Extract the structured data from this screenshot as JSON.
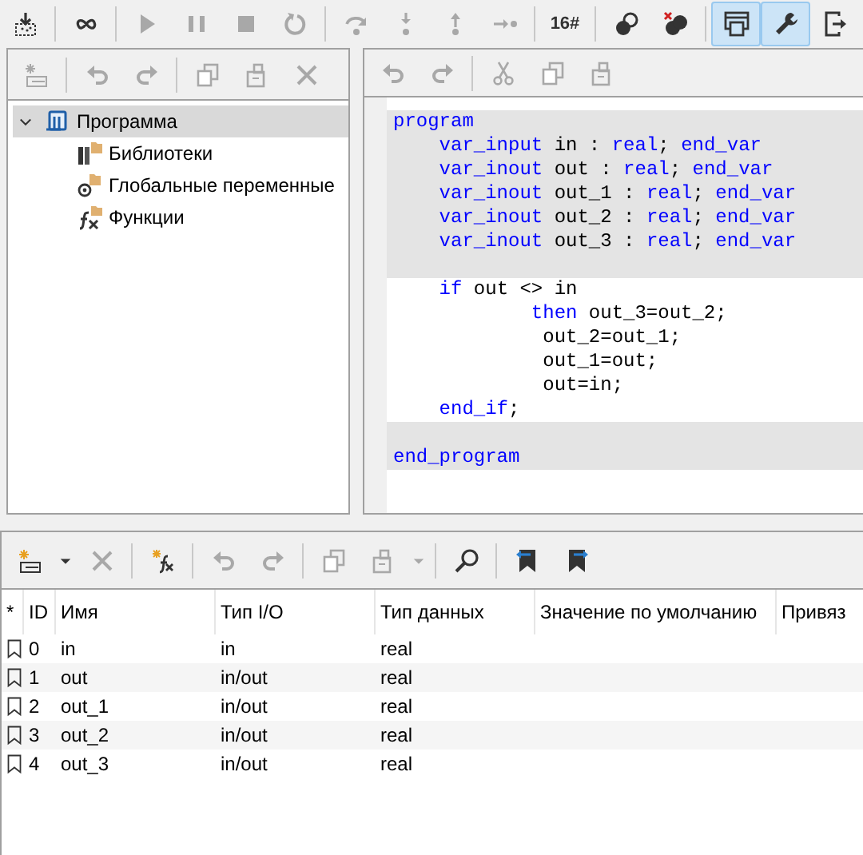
{
  "main_toolbar": [
    {
      "kind": "button",
      "disabled": false
    },
    {
      "kind": "separator"
    },
    {
      "kind": "button",
      "disabled": false
    },
    {
      "kind": "separator"
    },
    {
      "kind": "button",
      "disabled": true
    },
    {
      "kind": "button",
      "disabled": true
    },
    {
      "kind": "button",
      "disabled": true
    },
    {
      "kind": "button",
      "disabled": true
    },
    {
      "kind": "separator"
    },
    {
      "kind": "button",
      "disabled": true
    },
    {
      "kind": "button",
      "disabled": true
    },
    {
      "kind": "button",
      "disabled": true
    },
    {
      "kind": "button",
      "disabled": true
    },
    {
      "kind": "separator"
    },
    {
      "kind": "text-button",
      "label": "16#",
      "disabled": false
    },
    {
      "kind": "separator"
    },
    {
      "kind": "button",
      "disabled": false
    },
    {
      "kind": "button",
      "disabled": false
    },
    {
      "kind": "separator"
    },
    {
      "kind": "button",
      "disabled": false,
      "pressed": true
    },
    {
      "kind": "button",
      "disabled": false,
      "pressed": true
    },
    {
      "kind": "button",
      "disabled": false,
      "pressed": false
    }
  ],
  "tree_panel": {
    "toolbar": [
      {
        "kind": "button",
        "disabled": true
      },
      {
        "kind": "separator"
      },
      {
        "kind": "button",
        "disabled": true
      },
      {
        "kind": "button",
        "disabled": true
      },
      {
        "kind": "separator"
      },
      {
        "kind": "button",
        "disabled": true
      },
      {
        "kind": "button",
        "disabled": true
      },
      {
        "kind": "button",
        "disabled": true
      }
    ],
    "tree": [
      {
        "label": "Программа",
        "selected": true,
        "expanded": true,
        "children": [
          {
            "label": "Библиотеки",
            "selected": false
          },
          {
            "label": "Глобальные переменные",
            "selected": false
          },
          {
            "label": "Функции",
            "selected": false
          }
        ]
      }
    ]
  },
  "editor": {
    "toolbar": [
      {
        "kind": "button",
        "disabled": true
      },
      {
        "kind": "button",
        "disabled": true
      },
      {
        "kind": "separator"
      },
      {
        "kind": "button",
        "disabled": true
      },
      {
        "kind": "button",
        "disabled": true
      },
      {
        "kind": "button",
        "disabled": true
      }
    ],
    "lines": [
      {
        "shaded": true,
        "tokens": [
          {
            "kind": "keyword",
            "text": "program"
          }
        ]
      },
      {
        "shaded": true,
        "tokens": [
          {
            "kind": "keyword",
            "text": "    var_input"
          },
          {
            "kind": "plain",
            "text": " in : "
          },
          {
            "kind": "keyword",
            "text": "real"
          },
          {
            "kind": "plain",
            "text": "; "
          },
          {
            "kind": "keyword",
            "text": "end_var"
          }
        ]
      },
      {
        "shaded": true,
        "tokens": [
          {
            "kind": "keyword",
            "text": "    var_inout"
          },
          {
            "kind": "plain",
            "text": " out : "
          },
          {
            "kind": "keyword",
            "text": "real"
          },
          {
            "kind": "plain",
            "text": "; "
          },
          {
            "kind": "keyword",
            "text": "end_var"
          }
        ]
      },
      {
        "shaded": true,
        "tokens": [
          {
            "kind": "keyword",
            "text": "    var_inout"
          },
          {
            "kind": "plain",
            "text": " out_1 : "
          },
          {
            "kind": "keyword",
            "text": "real"
          },
          {
            "kind": "plain",
            "text": "; "
          },
          {
            "kind": "keyword",
            "text": "end_var"
          }
        ]
      },
      {
        "shaded": true,
        "tokens": [
          {
            "kind": "keyword",
            "text": "    var_inout"
          },
          {
            "kind": "plain",
            "text": " out_2 : "
          },
          {
            "kind": "keyword",
            "text": "real"
          },
          {
            "kind": "plain",
            "text": "; "
          },
          {
            "kind": "keyword",
            "text": "end_var"
          }
        ]
      },
      {
        "shaded": true,
        "tokens": [
          {
            "kind": "keyword",
            "text": "    var_inout"
          },
          {
            "kind": "plain",
            "text": " out_3 : "
          },
          {
            "kind": "keyword",
            "text": "real"
          },
          {
            "kind": "plain",
            "text": "; "
          },
          {
            "kind": "keyword",
            "text": "end_var"
          }
        ]
      },
      {
        "shaded": true
      },
      {
        "shaded": false,
        "tokens": [
          {
            "kind": "keyword",
            "text": "    if"
          },
          {
            "kind": "plain",
            "text": " out <> in"
          }
        ]
      },
      {
        "shaded": false,
        "tokens": [
          {
            "kind": "keyword",
            "text": "            then"
          },
          {
            "kind": "plain",
            "text": " out_3=out_2;"
          }
        ]
      },
      {
        "shaded": false,
        "tokens": [
          {
            "kind": "plain",
            "text": "             out_2=out_1;"
          }
        ]
      },
      {
        "shaded": false,
        "tokens": [
          {
            "kind": "plain",
            "text": "             out_1=out;"
          }
        ]
      },
      {
        "shaded": false,
        "tokens": [
          {
            "kind": "plain",
            "text": "             out=in;"
          }
        ]
      },
      {
        "shaded": false,
        "tokens": [
          {
            "kind": "keyword",
            "text": "    end_if"
          },
          {
            "kind": "plain",
            "text": ";"
          }
        ]
      },
      {
        "shaded": true
      },
      {
        "shaded": true,
        "tokens": [
          {
            "kind": "keyword",
            "text": "end_program"
          }
        ]
      }
    ]
  },
  "variables": {
    "toolbar": [
      {
        "kind": "button",
        "disabled": false
      },
      {
        "kind": "dropdown",
        "disabled": false
      },
      {
        "kind": "button",
        "disabled": true
      },
      {
        "kind": "separator"
      },
      {
        "kind": "button",
        "disabled": false
      },
      {
        "kind": "separator"
      },
      {
        "kind": "button",
        "disabled": true
      },
      {
        "kind": "button",
        "disabled": true
      },
      {
        "kind": "separator"
      },
      {
        "kind": "button",
        "disabled": true
      },
      {
        "kind": "button",
        "disabled": true
      },
      {
        "kind": "dropdown",
        "disabled": true
      },
      {
        "kind": "separator"
      },
      {
        "kind": "button",
        "disabled": false
      },
      {
        "kind": "separator"
      },
      {
        "kind": "button",
        "disabled": false
      },
      {
        "kind": "button",
        "disabled": false
      }
    ],
    "columns": [
      "*",
      "ID",
      "Имя",
      "Тип I/O",
      "Тип данных",
      "Значение по умолчанию",
      "Привяз"
    ],
    "rows": [
      {
        "id": "0",
        "name": "in",
        "io": "in",
        "type": "real"
      },
      {
        "id": "1",
        "name": "out",
        "io": "in/out",
        "type": "real"
      },
      {
        "id": "2",
        "name": "out_1",
        "io": "in/out",
        "type": "real"
      },
      {
        "id": "3",
        "name": "out_2",
        "io": "in/out",
        "type": "real"
      },
      {
        "id": "4",
        "name": "out_3",
        "io": "in/out",
        "type": "real"
      }
    ]
  }
}
